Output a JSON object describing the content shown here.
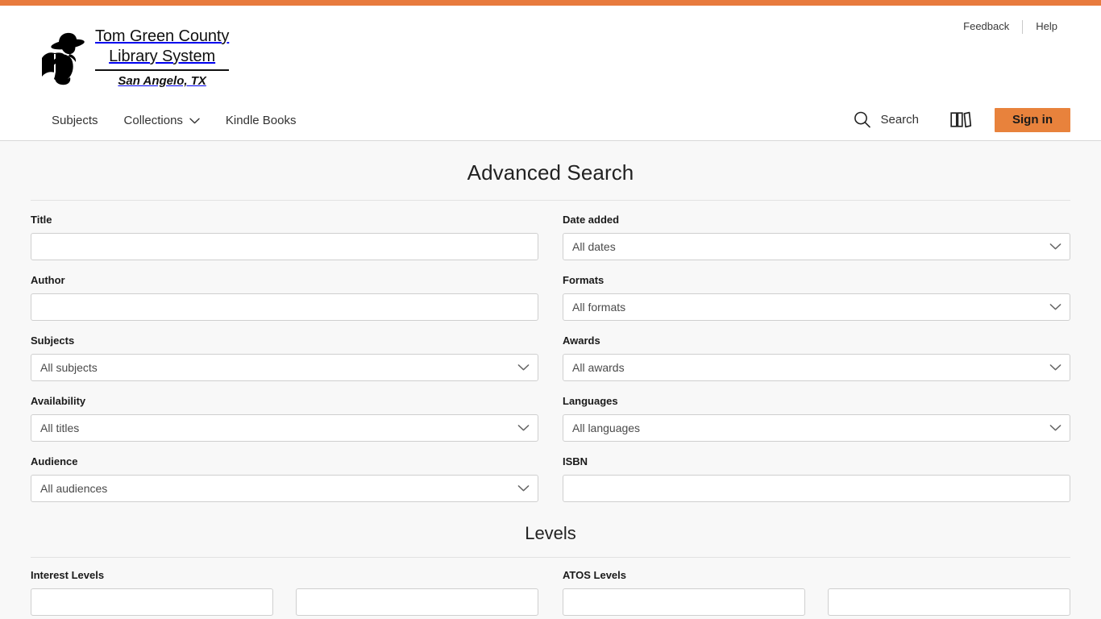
{
  "theme": {
    "accent_orange": "#e87b3e",
    "button_orange": "#e8823c",
    "page_background": "#f8f8f8",
    "header_background": "#ffffff",
    "border_gray": "#cfcfcf"
  },
  "utility_nav": {
    "feedback_label": "Feedback",
    "help_label": "Help"
  },
  "logo": {
    "line1": "Tom Green County",
    "line2": "Library System",
    "line3": "San Angelo, TX",
    "mark_name": "cowboy-reading-book-silhouette"
  },
  "main_nav": {
    "items": [
      {
        "label": "Subjects",
        "has_chevron": false
      },
      {
        "label": "Collections",
        "has_chevron": true
      },
      {
        "label": "Kindle Books",
        "has_chevron": false
      }
    ]
  },
  "header_actions": {
    "search_label": "Search",
    "shelf_icon_name": "bookshelf-icon",
    "signin_label": "Sign in"
  },
  "main": {
    "page_title": "Advanced Search",
    "levels_title": "Levels",
    "fields_left": [
      {
        "label": "Title",
        "type": "text",
        "value": "",
        "placeholder": ""
      },
      {
        "label": "Author",
        "type": "text",
        "value": "",
        "placeholder": ""
      },
      {
        "label": "Subjects",
        "type": "select",
        "value": "All subjects"
      },
      {
        "label": "Availability",
        "type": "select",
        "value": "All titles"
      },
      {
        "label": "Audience",
        "type": "select",
        "value": "All audiences"
      }
    ],
    "fields_right": [
      {
        "label": "Date added",
        "type": "select",
        "value": "All dates"
      },
      {
        "label": "Formats",
        "type": "select",
        "value": "All formats"
      },
      {
        "label": "Awards",
        "type": "select",
        "value": "All awards"
      },
      {
        "label": "Languages",
        "type": "select",
        "value": "All languages"
      },
      {
        "label": "ISBN",
        "type": "text",
        "value": "",
        "placeholder": ""
      }
    ],
    "levels": [
      {
        "label": "Interest Levels"
      },
      {
        "label": "ATOS Levels"
      }
    ]
  }
}
